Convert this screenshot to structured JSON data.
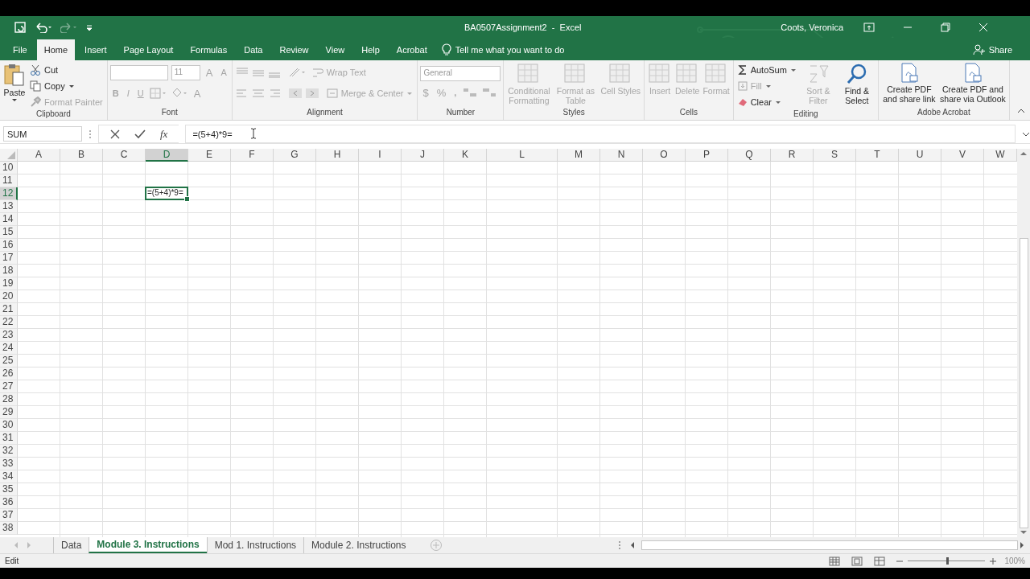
{
  "window": {
    "title": "BA0507Assignment2  -  Excel",
    "user": "Coots, Veronica"
  },
  "quick_access": {
    "redo_disabled": true
  },
  "tabs": [
    {
      "label": "File",
      "selected": false
    },
    {
      "label": "Home",
      "selected": true
    },
    {
      "label": "Insert",
      "selected": false
    },
    {
      "label": "Page Layout",
      "selected": false
    },
    {
      "label": "Formulas",
      "selected": false
    },
    {
      "label": "Data",
      "selected": false
    },
    {
      "label": "Review",
      "selected": false
    },
    {
      "label": "View",
      "selected": false
    },
    {
      "label": "Help",
      "selected": false
    },
    {
      "label": "Acrobat",
      "selected": false
    }
  ],
  "tell_me": "Tell me what you want to do",
  "share": "Share",
  "ribbon": [
    {
      "kind": "clipboard",
      "label": "Clipboard",
      "paste": "Paste",
      "items": [
        {
          "label": "Cut",
          "disabled": false
        },
        {
          "label": "Copy",
          "disabled": false
        },
        {
          "label": "Format Painter",
          "disabled": true
        }
      ]
    },
    {
      "kind": "font",
      "label": "Font",
      "size": "11",
      "grow": "A",
      "shrink": "A",
      "bold": "B",
      "italic": "I",
      "underline": "U",
      "font_color_glyph": "A"
    },
    {
      "kind": "alignment",
      "label": "Alignment",
      "items": [
        {
          "label": "Wrap Text",
          "disabled": true
        },
        {
          "label": "Merge & Center",
          "disabled": true
        }
      ]
    },
    {
      "kind": "number",
      "label": "Number",
      "format": "General",
      "currency": "$",
      "percent": "%",
      "comma": ","
    },
    {
      "kind": "large",
      "label": "Styles",
      "items": [
        {
          "label": "Conditional Formatting",
          "disabled": true
        },
        {
          "label": "Format as Table",
          "disabled": true
        },
        {
          "label": "Cell Styles",
          "disabled": true
        }
      ]
    },
    {
      "kind": "large",
      "label": "Cells",
      "items": [
        {
          "label": "Insert",
          "disabled": true
        },
        {
          "label": "Delete",
          "disabled": true
        },
        {
          "label": "Format",
          "disabled": true
        }
      ]
    },
    {
      "kind": "editing",
      "label": "Editing",
      "items": [
        {
          "label": "AutoSum",
          "disabled": false
        },
        {
          "label": "Fill",
          "disabled": true
        },
        {
          "label": "Clear",
          "disabled": false
        }
      ],
      "large": [
        {
          "label": "Sort & Filter",
          "disabled": true
        },
        {
          "label": "Find & Select",
          "disabled": false
        }
      ]
    },
    {
      "kind": "acrobat",
      "label": "Adobe Acrobat",
      "items": [
        {
          "label": "Create PDF and share link",
          "disabled": false
        },
        {
          "label": "Create PDF and share via Outlook",
          "disabled": false
        }
      ]
    }
  ],
  "formula_bar": {
    "name_box": "SUM",
    "fx": "fx",
    "formula": "=(5+4)*9="
  },
  "columns": [
    {
      "label": "A",
      "selected": false
    },
    {
      "label": "B",
      "selected": false
    },
    {
      "label": "C",
      "selected": false
    },
    {
      "label": "D",
      "selected": true
    },
    {
      "label": "E",
      "selected": false
    },
    {
      "label": "F",
      "selected": false
    },
    {
      "label": "G",
      "selected": false
    },
    {
      "label": "H",
      "selected": false
    },
    {
      "label": "I",
      "selected": false
    },
    {
      "label": "J",
      "selected": false
    },
    {
      "label": "K",
      "selected": false
    },
    {
      "label": "L",
      "selected": false
    },
    {
      "label": "M",
      "selected": false
    },
    {
      "label": "N",
      "selected": false
    },
    {
      "label": "O",
      "selected": false
    },
    {
      "label": "P",
      "selected": false
    },
    {
      "label": "Q",
      "selected": false
    },
    {
      "label": "R",
      "selected": false
    },
    {
      "label": "S",
      "selected": false
    },
    {
      "label": "T",
      "selected": false
    },
    {
      "label": "U",
      "selected": false
    },
    {
      "label": "V",
      "selected": false
    },
    {
      "label": "W",
      "selected": false
    }
  ],
  "rows": [
    {
      "label": "10",
      "selected": false
    },
    {
      "label": "11",
      "selected": false
    },
    {
      "label": "12",
      "selected": true,
      "active_cell": "=(5+4)*9="
    },
    {
      "label": "13",
      "selected": false
    },
    {
      "label": "14",
      "selected": false
    },
    {
      "label": "15",
      "selected": false
    },
    {
      "label": "16",
      "selected": false
    },
    {
      "label": "17",
      "selected": false
    },
    {
      "label": "18",
      "selected": false
    },
    {
      "label": "19",
      "selected": false
    },
    {
      "label": "20",
      "selected": false
    },
    {
      "label": "21",
      "selected": false
    },
    {
      "label": "22",
      "selected": false
    },
    {
      "label": "23",
      "selected": false
    },
    {
      "label": "24",
      "selected": false
    },
    {
      "label": "25",
      "selected": false
    },
    {
      "label": "26",
      "selected": false
    },
    {
      "label": "27",
      "selected": false
    },
    {
      "label": "28",
      "selected": false
    },
    {
      "label": "29",
      "selected": false
    },
    {
      "label": "30",
      "selected": false
    },
    {
      "label": "31",
      "selected": false
    },
    {
      "label": "32",
      "selected": false
    },
    {
      "label": "33",
      "selected": false
    },
    {
      "label": "34",
      "selected": false
    },
    {
      "label": "35",
      "selected": false
    },
    {
      "label": "36",
      "selected": false
    },
    {
      "label": "37",
      "selected": false
    },
    {
      "label": "38",
      "selected": false
    }
  ],
  "sheets": [
    {
      "label": "Data",
      "selected": false
    },
    {
      "label": "Module 3. Instructions",
      "selected": true
    },
    {
      "label": "Mod 1. Instructions",
      "selected": false
    },
    {
      "label": "Module 2. Instructions",
      "selected": false
    }
  ],
  "status_bar": {
    "mode": "Edit",
    "zoom": "100%",
    "level": 0.5
  }
}
